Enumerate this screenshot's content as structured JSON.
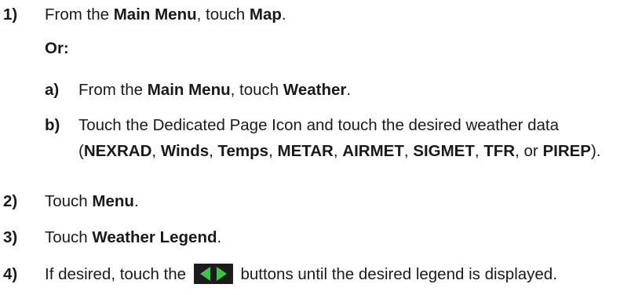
{
  "steps": [
    {
      "number": "1)",
      "parts": [
        "From the ",
        "Main Menu",
        ", touch ",
        "Map",
        "."
      ]
    },
    {
      "or_label": "Or:"
    },
    {
      "number": "a)",
      "parts": [
        "From the ",
        "Main Menu",
        ", touch ",
        "Weather",
        "."
      ]
    },
    {
      "number": "b)",
      "parts": [
        "Touch the Dedicated Page Icon and touch the desired weather data (",
        "NEXRAD",
        ", ",
        "Winds",
        ", ",
        "Temps",
        ", ",
        "METAR",
        ", ",
        "AIRMET",
        ", ",
        "SIGMET",
        ", ",
        "TFR",
        ", or ",
        "PIREP",
        ")."
      ]
    },
    {
      "number": "2)",
      "parts": [
        "Touch ",
        "Menu",
        "."
      ]
    },
    {
      "number": "3)",
      "parts": [
        "Touch ",
        "Weather Legend",
        "."
      ]
    },
    {
      "number": "4)",
      "parts": [
        "If desired, touch the ",
        " buttons until the desired legend is displayed."
      ]
    }
  ],
  "icons": {
    "arrow_buttons": "left-right-arrow-buttons-icon",
    "arrow_color": "#3ec44a",
    "arrow_background": "#1c1c1c"
  }
}
